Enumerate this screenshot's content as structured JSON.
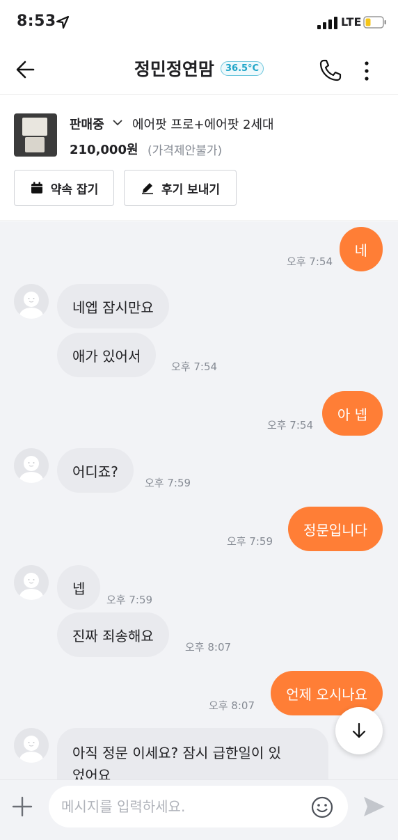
{
  "status_bar": {
    "time": "8:53",
    "network": "LTE",
    "icons": [
      "location-arrow-icon",
      "signal-icon",
      "battery-icon"
    ]
  },
  "header": {
    "title": "정민정연맘",
    "manner_temp": "36.5°C",
    "icons": [
      "back-arrow-icon",
      "phone-icon",
      "more-icon"
    ]
  },
  "product": {
    "status": "판매중",
    "name": "에어팟 프로+에어팟 2세대",
    "price": "210,000원",
    "negotiation": "(가격제안불가)",
    "buttons": {
      "appointment": "약속 잡기",
      "review": "후기 보내기"
    }
  },
  "messages": [
    {
      "from": "me",
      "text": "네",
      "time": "오후 7:54"
    },
    {
      "from": "them",
      "text": "네엡 잠시만요",
      "time": ""
    },
    {
      "from": "them",
      "text": "애가 있어서",
      "time": "오후 7:54"
    },
    {
      "from": "me",
      "text": "아 넵",
      "time": "오후 7:54"
    },
    {
      "from": "them",
      "text": "어디죠?",
      "time": "오후 7:59"
    },
    {
      "from": "me",
      "text": "정문입니다",
      "time": "오후 7:59"
    },
    {
      "from": "them",
      "text": "넵",
      "time": "오후 7:59"
    },
    {
      "from": "them",
      "text": "진짜 죄송해요",
      "time": "오후 8:07"
    },
    {
      "from": "me",
      "text": "언제 오시나요",
      "time": "오후 8:07"
    },
    {
      "from": "them",
      "text": "아직 정문 이세요? 잠시 급한일이 있",
      "text_line2": "었어요",
      "time": ""
    }
  ],
  "input": {
    "placeholder": "메시지를 입력하세요."
  },
  "colors": {
    "accent": "#ff7e36",
    "temp": "#1fa5c8",
    "chat_bg": "#f2f3f6",
    "bubble_them": "#e9eaee"
  }
}
